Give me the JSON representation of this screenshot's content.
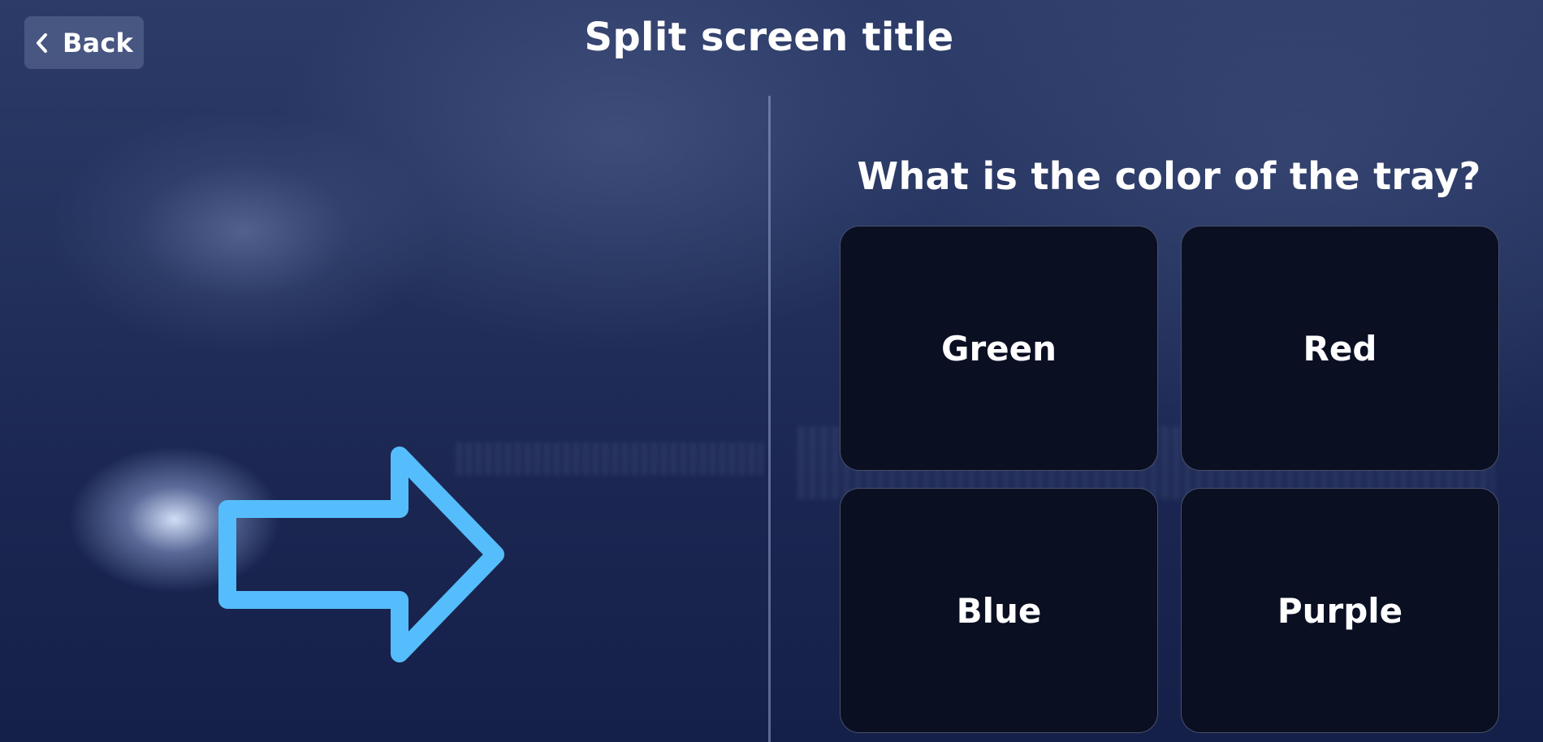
{
  "header": {
    "back_label": "Back",
    "title": "Split screen title"
  },
  "left_pane": {
    "icon": "arrow-right-icon",
    "icon_color": "#55bdfb"
  },
  "right_pane": {
    "question": "What is the color of the tray?",
    "answers": [
      {
        "label": "Green"
      },
      {
        "label": "Red"
      },
      {
        "label": "Blue"
      },
      {
        "label": "Purple"
      }
    ]
  },
  "colors": {
    "background": "#1e2a56",
    "answer_card": "#0a0f22",
    "text": "#ffffff"
  }
}
